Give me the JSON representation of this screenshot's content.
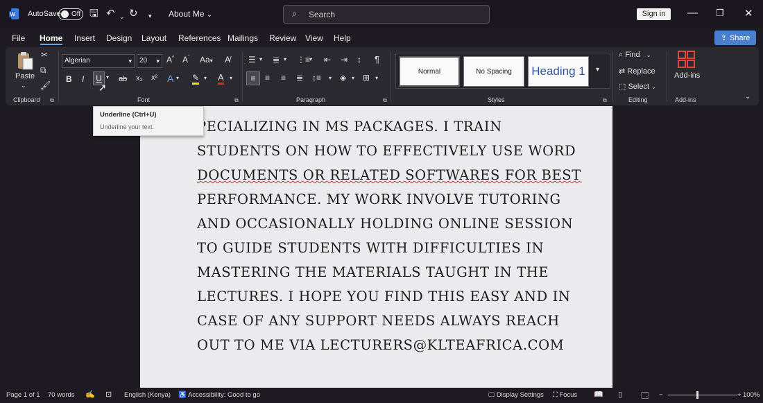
{
  "titlebar": {
    "autosave_label": "AutoSave",
    "autosave_state": "Off",
    "doc_title": "About Me",
    "search_placeholder": "Search",
    "sign_in": "Sign in"
  },
  "tabs": [
    "File",
    "Home",
    "Insert",
    "Design",
    "Layout",
    "References",
    "Mailings",
    "Review",
    "View",
    "Help"
  ],
  "active_tab": "Home",
  "share_label": "Share",
  "ribbon": {
    "clipboard": {
      "paste": "Paste",
      "label": "Clipboard"
    },
    "font": {
      "font_name": "Algerian",
      "font_size": "20",
      "bold": "B",
      "italic": "I",
      "underline": "U",
      "strike": "ab",
      "subscript": "x₂",
      "superscript": "x²",
      "change_case": "Aa",
      "label": "Font"
    },
    "paragraph": {
      "label": "Paragraph",
      "pilcrow": "¶"
    },
    "styles": {
      "items": [
        "Normal",
        "No Spacing",
        "Heading 1"
      ],
      "label": "Styles"
    },
    "editing": {
      "find": "Find",
      "replace": "Replace",
      "select": "Select",
      "label": "Editing"
    },
    "addins": {
      "button": "Add-ins",
      "label": "Add-ins"
    }
  },
  "tooltip": {
    "title": "Underline (Ctrl+U)",
    "description": "Underline your text."
  },
  "document": {
    "lines": [
      "specializing in MS packages. I train",
      "students on how to effectively use word",
      "documents or related softwares for best",
      "performance. My work involve tutoring",
      "and occasionally holding online session",
      "to guide students with difficulties in",
      "mastering the materials taught in the",
      "lectures. I hope you find this easy and in",
      "case of any support needs always reach",
      "out to me via lecturers@klteafrica.com"
    ],
    "first_line_display": "PECIALIZING IN MS PACKAGES. I TRAIN"
  },
  "statusbar": {
    "page": "Page 1 of 1",
    "words": "70 words",
    "language": "English (Kenya)",
    "accessibility": "Accessibility: Good to go",
    "display_settings": "Display Settings",
    "focus": "Focus",
    "zoom": "100%"
  },
  "colors": {
    "accent": "#4a7fcf",
    "ribbon_bg": "#2c2a31",
    "page_bg": "#ebebed"
  }
}
